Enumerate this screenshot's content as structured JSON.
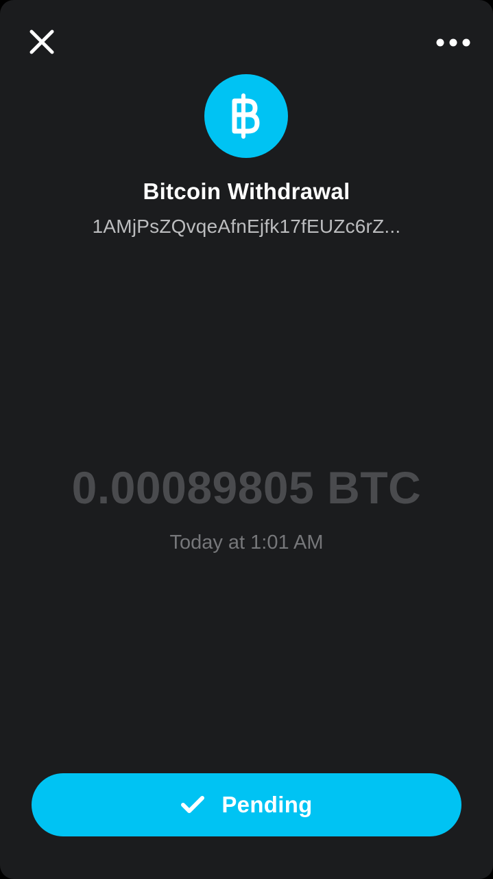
{
  "header": {
    "close_icon": "close-icon",
    "more_icon": "more-horizontal-icon"
  },
  "transaction": {
    "icon": "bitcoin-icon",
    "title": "Bitcoin Withdrawal",
    "address": "1AMjPsZQvqeAfnEjfk17fEUZc6rZ...",
    "amount": "0.00089805 BTC",
    "timestamp": "Today at 1:01 AM"
  },
  "status": {
    "icon": "checkmark-icon",
    "label": "Pending"
  },
  "colors": {
    "background": "#1b1c1e",
    "accent": "#00c3f3",
    "amount_text": "#4a4b4e",
    "secondary_text": "#bcbdbf"
  }
}
